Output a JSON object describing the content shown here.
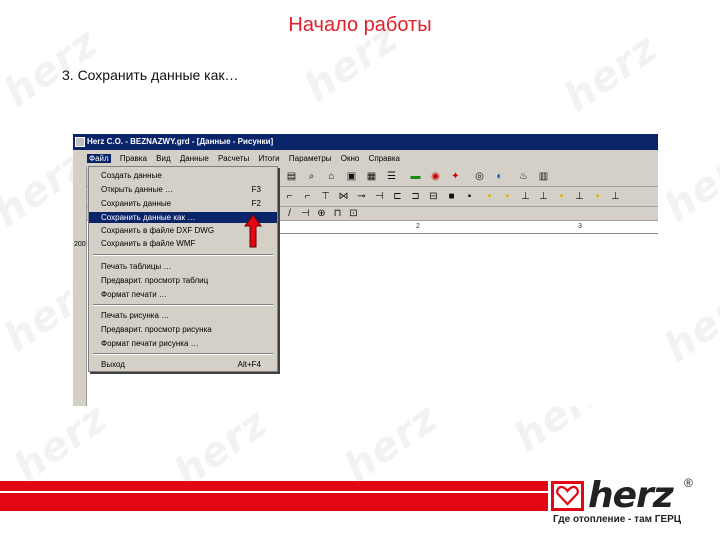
{
  "slide": {
    "title": "Начало работы",
    "step": "3. Сохранить данные как…"
  },
  "window": {
    "title": "Herz C.O. - BEZNAZWY.grd - [Данные - Рисунки]"
  },
  "menubar": {
    "items": [
      "Файл",
      "Правка",
      "Вид",
      "Данные",
      "Расчеты",
      "Итоги",
      "Параметры",
      "Окно",
      "Справка"
    ]
  },
  "left_strip_label": "200",
  "ruler": {
    "marks": [
      "2",
      "3"
    ]
  },
  "file_menu": {
    "items": [
      {
        "label": "Создать данные",
        "shortcut": ""
      },
      {
        "label": "Открыть данные …",
        "shortcut": "F3"
      },
      {
        "label": "Сохранить данные",
        "shortcut": "F2"
      },
      {
        "label": "Сохранить данные как …",
        "shortcut": ""
      },
      {
        "label": "Сохранить в файле DXF DWG",
        "shortcut": ""
      },
      {
        "label": "Сохранить в файле WMF",
        "shortcut": ""
      },
      {
        "label": "Печать таблицы …",
        "shortcut": ""
      },
      {
        "label": "Предварит. просмотр таблиц",
        "shortcut": ""
      },
      {
        "label": "Формат печати …",
        "shortcut": ""
      },
      {
        "label": "Печать рисунка …",
        "shortcut": ""
      },
      {
        "label": "Предварит. просмотр рисунка",
        "shortcut": ""
      },
      {
        "label": "Формат печати рисунка …",
        "shortcut": ""
      },
      {
        "label": "Выход",
        "shortcut": "Alt+F4"
      }
    ],
    "selected_index": 3
  },
  "footer": {
    "logo_text": "herz",
    "registered": "®",
    "tagline": "Где отопление - там ГЕРЦ"
  },
  "colors": {
    "accent_red": "#e30613",
    "title_red": "#e0202a",
    "selection_blue": "#0a246a"
  }
}
